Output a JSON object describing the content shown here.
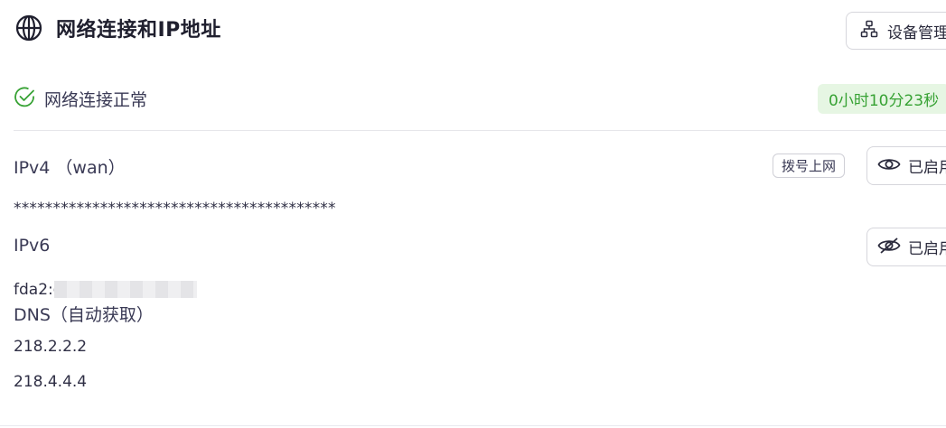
{
  "header": {
    "title": "网络连接和IP地址",
    "device_button": "设备管理"
  },
  "status": {
    "text": "网络连接正常",
    "uptime": "0小时10分23秒"
  },
  "ipv4": {
    "label": "IPv4 （wan）",
    "dial_tag": "拨号上网",
    "toggle_label": "已启用",
    "address": "*****************************************"
  },
  "ipv6": {
    "label": "IPv6",
    "toggle_label": "已启用",
    "address_prefix": "fda2:e"
  },
  "dns": {
    "label": "DNS（自动获取）",
    "servers": [
      "218.2.2.2",
      "218.4.4.4"
    ]
  },
  "colors": {
    "accent_green": "#37a234",
    "green_bg": "#e6f6e3",
    "text": "#2f2f45"
  },
  "icons": {
    "header": "globe-icon",
    "device": "network-tree-icon",
    "status": "check-circle-icon",
    "ipv4_toggle": "eye-icon",
    "ipv6_toggle": "eye-off-icon"
  }
}
